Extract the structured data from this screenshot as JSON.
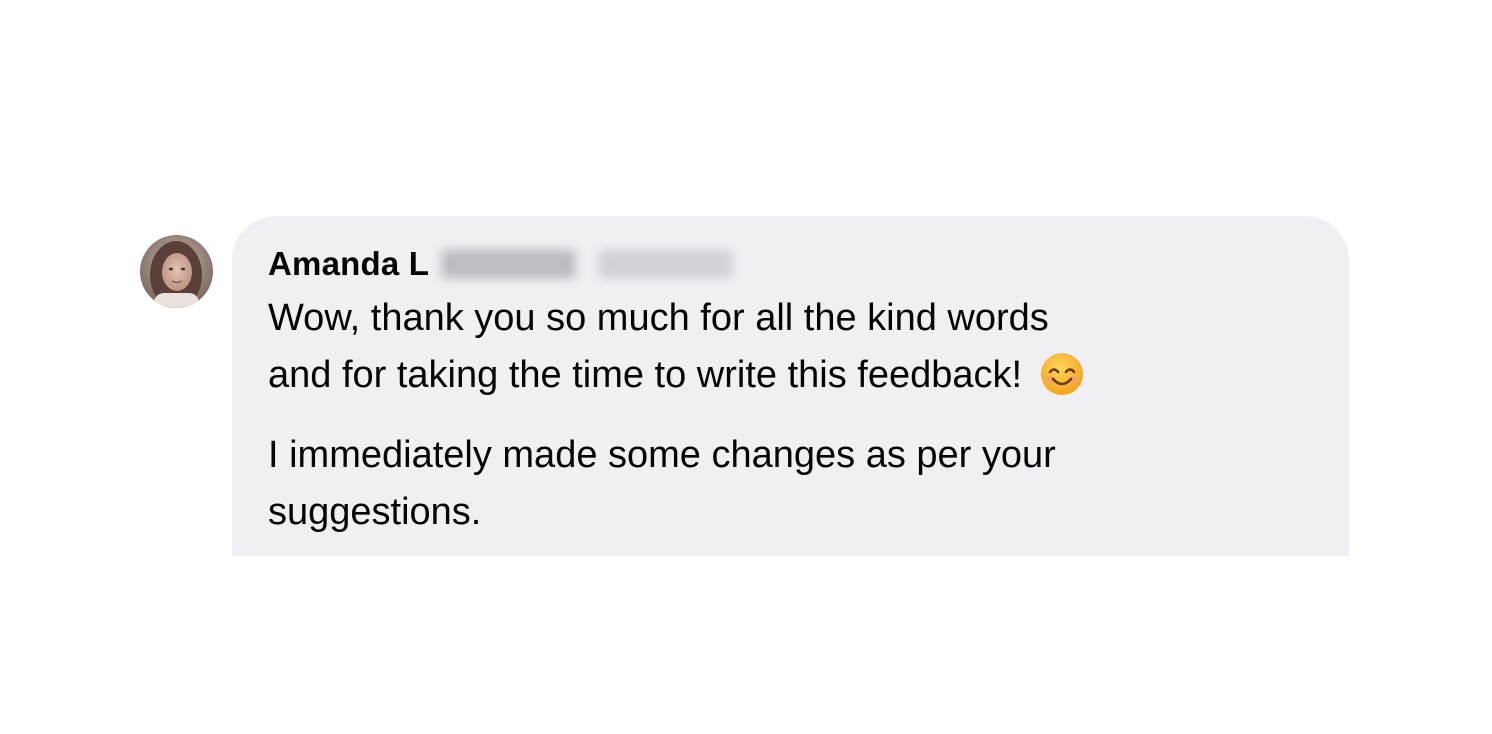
{
  "comment": {
    "author": "Amanda L",
    "author_extra_blurred": "",
    "badge_blurred": "",
    "paragraphs": [
      {
        "line1": "Wow, thank you so much for all the kind words",
        "line2": "and for taking the time to write this feedback!",
        "emoji": "smiling-face-icon"
      },
      {
        "line1": "I immediately made some changes as per your",
        "line2": "suggestions."
      }
    ]
  },
  "colors": {
    "bubble_background": "#f0f0f4",
    "text": "#050505",
    "page_background": "#ffffff"
  }
}
